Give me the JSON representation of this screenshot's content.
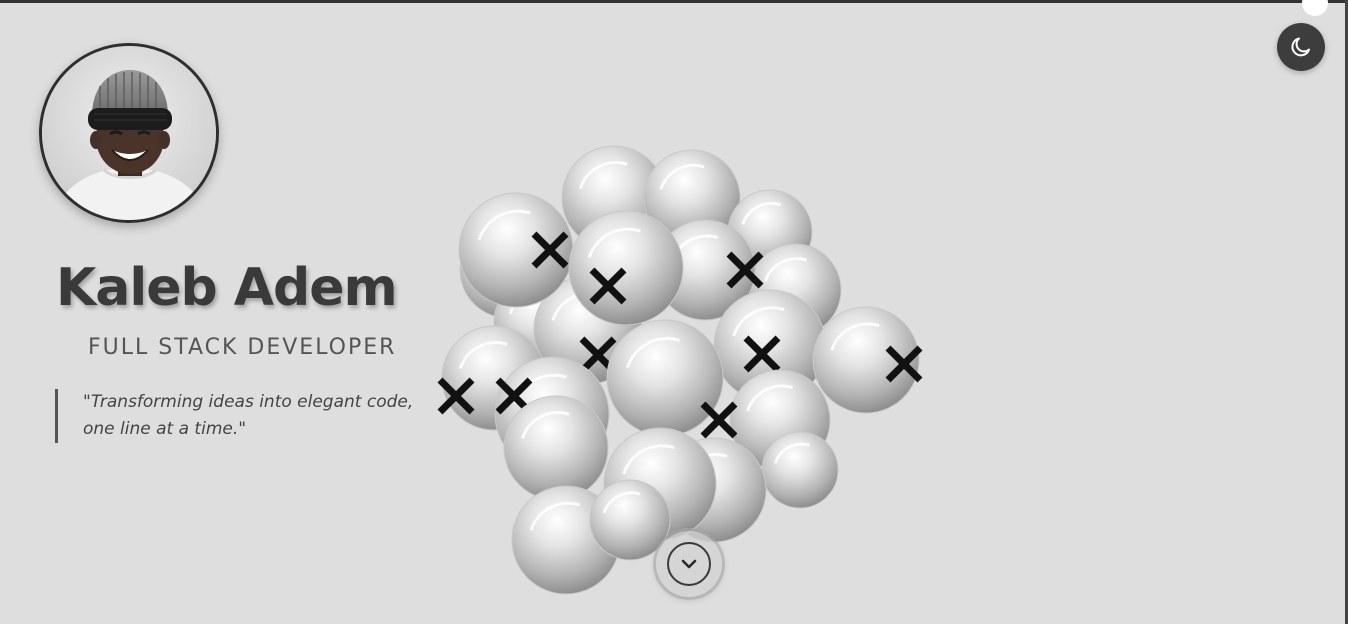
{
  "hero": {
    "name": "Kaleb Adem",
    "role": "FULL STACK DEVELOPER",
    "quote": "\"Transforming ideas into elegant code, one line at a time.\""
  },
  "icons": {
    "theme_toggle": "moon-icon",
    "scroll_down": "chevron-down-icon",
    "sphere_mark": "cross-icon"
  },
  "colors": {
    "background": "#dedede",
    "text_primary": "#3a3a3a",
    "toggle_bg": "#3d3d3d"
  }
}
